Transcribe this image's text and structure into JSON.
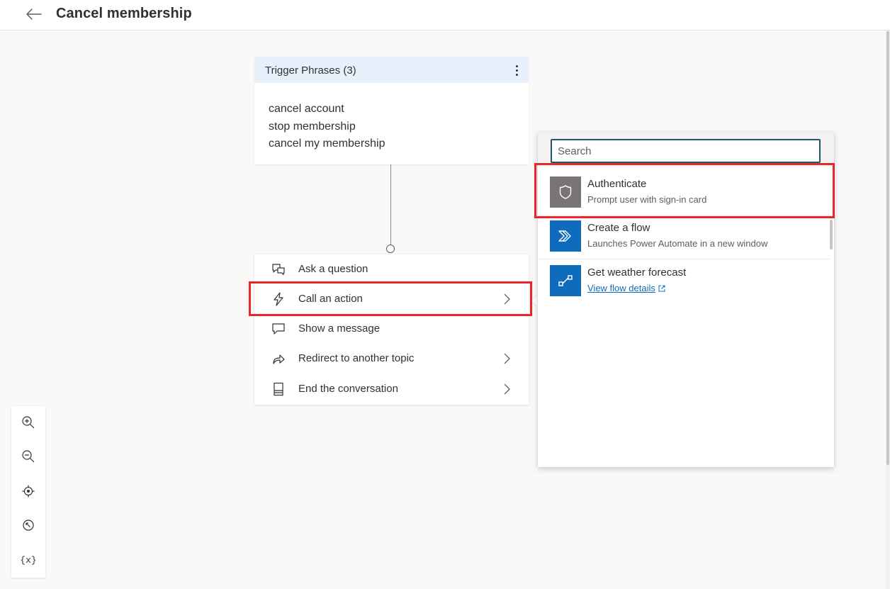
{
  "header": {
    "title": "Cancel membership"
  },
  "trigger": {
    "title": "Trigger Phrases (3)",
    "phrases": [
      "cancel account",
      "stop membership",
      "cancel my membership"
    ]
  },
  "node_menu": {
    "items": [
      {
        "label": "Ask a question",
        "icon": "chat-question-icon",
        "has_submenu": false
      },
      {
        "label": "Call an action",
        "icon": "lightning-icon",
        "has_submenu": true,
        "highlighted": true
      },
      {
        "label": "Show a message",
        "icon": "message-icon",
        "has_submenu": false
      },
      {
        "label": "Redirect to another topic",
        "icon": "redirect-arrow-icon",
        "has_submenu": true
      },
      {
        "label": "End the conversation",
        "icon": "end-conversation-icon",
        "has_submenu": true
      }
    ]
  },
  "flyout": {
    "search_placeholder": "Search",
    "actions": [
      {
        "title": "Authenticate",
        "subtitle": "Prompt user with sign-in card",
        "icon": "shield-icon",
        "icon_bg": "#7a7574",
        "highlighted": true
      },
      {
        "title": "Create a flow",
        "subtitle": "Launches Power Automate in a new window",
        "icon": "power-automate-icon",
        "icon_bg": "#0f6cbd"
      },
      {
        "title": "Get weather forecast",
        "link": "View flow details",
        "icon": "flow-icon",
        "icon_bg": "#0f6cbd"
      }
    ]
  },
  "zoom_toolbar": {
    "buttons": [
      "zoom-in-icon",
      "zoom-out-icon",
      "recenter-icon",
      "minimap-icon",
      "variables-icon"
    ],
    "variables_label": "{x}"
  },
  "colors": {
    "accent": "#0f6cbd",
    "highlight": "#e8262b",
    "trigger_header": "#e7f1fb",
    "canvas": "#faf9f8"
  }
}
